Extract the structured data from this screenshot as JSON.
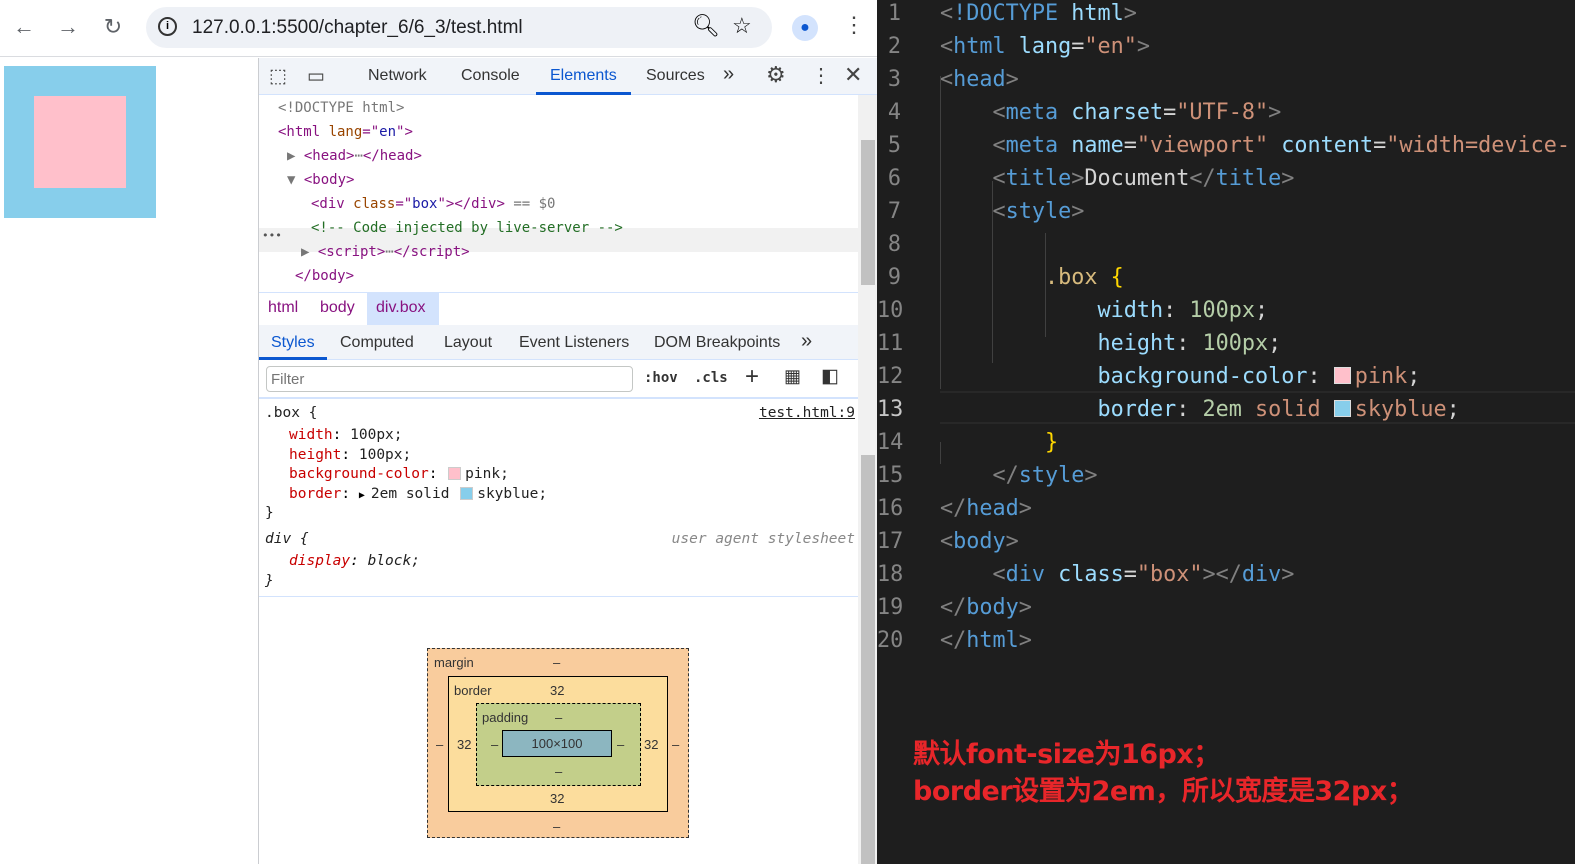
{
  "browser": {
    "url": "127.0.0.1:5500/chapter_6/6_3/test.html",
    "back_icon": "arrow-left",
    "forward_icon": "arrow-right",
    "reload_icon": "reload"
  },
  "page_box": {
    "background": "#ffc0cb",
    "border_color": "#87ceeb"
  },
  "devtools": {
    "tabs": [
      "Network",
      "Console",
      "Elements",
      "Sources"
    ],
    "active_tab": "Elements",
    "more": "»",
    "tree": [
      [
        [
          "<!DOCTYPE html>",
          "dt"
        ]
      ],
      [
        [
          "<html ",
          "tg"
        ],
        [
          "lang",
          "at"
        ],
        [
          "=\"",
          "tg"
        ],
        [
          "en",
          "av"
        ],
        [
          "\">",
          "tg"
        ]
      ],
      [
        [
          "▶ ",
          "dt"
        ],
        [
          "<head>",
          "tg"
        ],
        [
          "⋯",
          "dt"
        ],
        [
          "</head>",
          "tg"
        ]
      ],
      [
        [
          "▼ ",
          "dt"
        ],
        [
          "<body>",
          "tg"
        ]
      ],
      [
        [
          "<div ",
          "tg"
        ],
        [
          "class",
          "at"
        ],
        [
          "=\"",
          "tg"
        ],
        [
          "box",
          "av"
        ],
        [
          "\"></div>",
          "tg"
        ],
        [
          " == $0",
          "dt"
        ]
      ],
      [
        [
          "<!-- Code injected by live-server -->",
          "cm"
        ]
      ],
      [
        [
          "▶ ",
          "dt"
        ],
        [
          "<script>",
          "tg"
        ],
        [
          "⋯",
          "dt"
        ],
        [
          "</script>",
          "tg"
        ]
      ],
      [
        [
          "</body>",
          "tg"
        ]
      ]
    ],
    "row_dots": "•••",
    "breadcrumbs": [
      "html",
      "body",
      "div.box"
    ],
    "subtabs": [
      "Styles",
      "Computed",
      "Layout",
      "Event Listeners",
      "DOM Breakpoints"
    ],
    "filter_placeholder": "Filter",
    "hov": ":hov",
    "cls": ".cls",
    "rule1": {
      "selector": ".box {",
      "source": "test.html:9",
      "props": [
        [
          "width",
          "100px;"
        ],
        [
          "height",
          "100px;"
        ],
        [
          "background-color",
          "pink;"
        ],
        [
          "border",
          "2em solid skyblue;"
        ]
      ],
      "close": "}"
    },
    "rule2": {
      "selector": "div {",
      "source": "user agent stylesheet",
      "props": [
        [
          "display",
          "block;"
        ]
      ],
      "close": "}"
    },
    "box_model": {
      "margin_label": "margin",
      "border_label": "border",
      "padding_label": "padding",
      "margin": "–",
      "border": "32",
      "padding": "–",
      "content": "100×100"
    }
  },
  "editor": {
    "lines": [
      [
        [
          "<",
          "p"
        ],
        [
          "!DOCTYPE",
          "t"
        ],
        [
          " html",
          "a"
        ],
        [
          ">",
          "p"
        ]
      ],
      [
        [
          "<",
          "p"
        ],
        [
          "html",
          "t"
        ],
        [
          " lang",
          "a"
        ],
        [
          "=",
          "x"
        ],
        [
          "\"en\"",
          "s"
        ],
        [
          ">",
          "p"
        ]
      ],
      [
        [
          "<",
          "p"
        ],
        [
          "head",
          "t"
        ],
        [
          ">",
          "p"
        ]
      ],
      [
        [
          "    <",
          "p"
        ],
        [
          "meta",
          "t"
        ],
        [
          " charset",
          "a"
        ],
        [
          "=",
          "x"
        ],
        [
          "\"UTF-8\"",
          "s"
        ],
        [
          ">",
          "p"
        ]
      ],
      [
        [
          "    <",
          "p"
        ],
        [
          "meta",
          "t"
        ],
        [
          " name",
          "a"
        ],
        [
          "=",
          "x"
        ],
        [
          "\"viewport\"",
          "s"
        ],
        [
          " content",
          "a"
        ],
        [
          "=",
          "x"
        ],
        [
          "\"width=device-",
          "s"
        ]
      ],
      [
        [
          "    <",
          "p"
        ],
        [
          "title",
          "t"
        ],
        [
          ">",
          "p"
        ],
        [
          "Document",
          "x"
        ],
        [
          "</",
          "p"
        ],
        [
          "title",
          "t"
        ],
        [
          ">",
          "p"
        ]
      ],
      [
        [
          "    <",
          "p"
        ],
        [
          "style",
          "t"
        ],
        [
          ">",
          "p"
        ]
      ],
      [],
      [
        [
          "        .box",
          "sel"
        ],
        [
          " {",
          "b"
        ]
      ],
      [
        [
          "            width",
          "a"
        ],
        [
          ": ",
          "x"
        ],
        [
          "100px",
          "n"
        ],
        [
          ";",
          "x"
        ]
      ],
      [
        [
          "            height",
          "a"
        ],
        [
          ": ",
          "x"
        ],
        [
          "100px",
          "n"
        ],
        [
          ";",
          "x"
        ]
      ],
      [
        [
          "            background-color",
          "a"
        ],
        [
          ": ",
          "x"
        ],
        [
          "SW:#ffc0cb",
          ""
        ],
        [
          "pink",
          "s"
        ],
        [
          ";",
          "x"
        ]
      ],
      [
        [
          "            border",
          "a"
        ],
        [
          ": ",
          "x"
        ],
        [
          "2em",
          "n"
        ],
        [
          " solid ",
          "s"
        ],
        [
          "SW:#87ceeb",
          ""
        ],
        [
          "skyblue",
          "s"
        ],
        [
          ";",
          "x"
        ]
      ],
      [
        [
          "        }",
          "b"
        ]
      ],
      [
        [
          "    </",
          "p"
        ],
        [
          "style",
          "t"
        ],
        [
          ">",
          "p"
        ]
      ],
      [
        [
          "</",
          "p"
        ],
        [
          "head",
          "t"
        ],
        [
          ">",
          "p"
        ]
      ],
      [
        [
          "<",
          "p"
        ],
        [
          "body",
          "t"
        ],
        [
          ">",
          "p"
        ]
      ],
      [
        [
          "    <",
          "p"
        ],
        [
          "div",
          "t"
        ],
        [
          " class",
          "a"
        ],
        [
          "=",
          "x"
        ],
        [
          "\"box\"",
          "s"
        ],
        [
          "></",
          "p"
        ],
        [
          "div",
          "t"
        ],
        [
          ">",
          "p"
        ]
      ],
      [
        [
          "</",
          "p"
        ],
        [
          "body",
          "t"
        ],
        [
          ">",
          "p"
        ]
      ],
      [
        [
          "</",
          "p"
        ],
        [
          "html",
          "t"
        ],
        [
          ">",
          "p"
        ]
      ]
    ]
  },
  "annotation": {
    "line1": "默认font-size为16px；",
    "line2": "border设置为2em，所以宽度是32px；",
    "color": "#e8262a"
  }
}
